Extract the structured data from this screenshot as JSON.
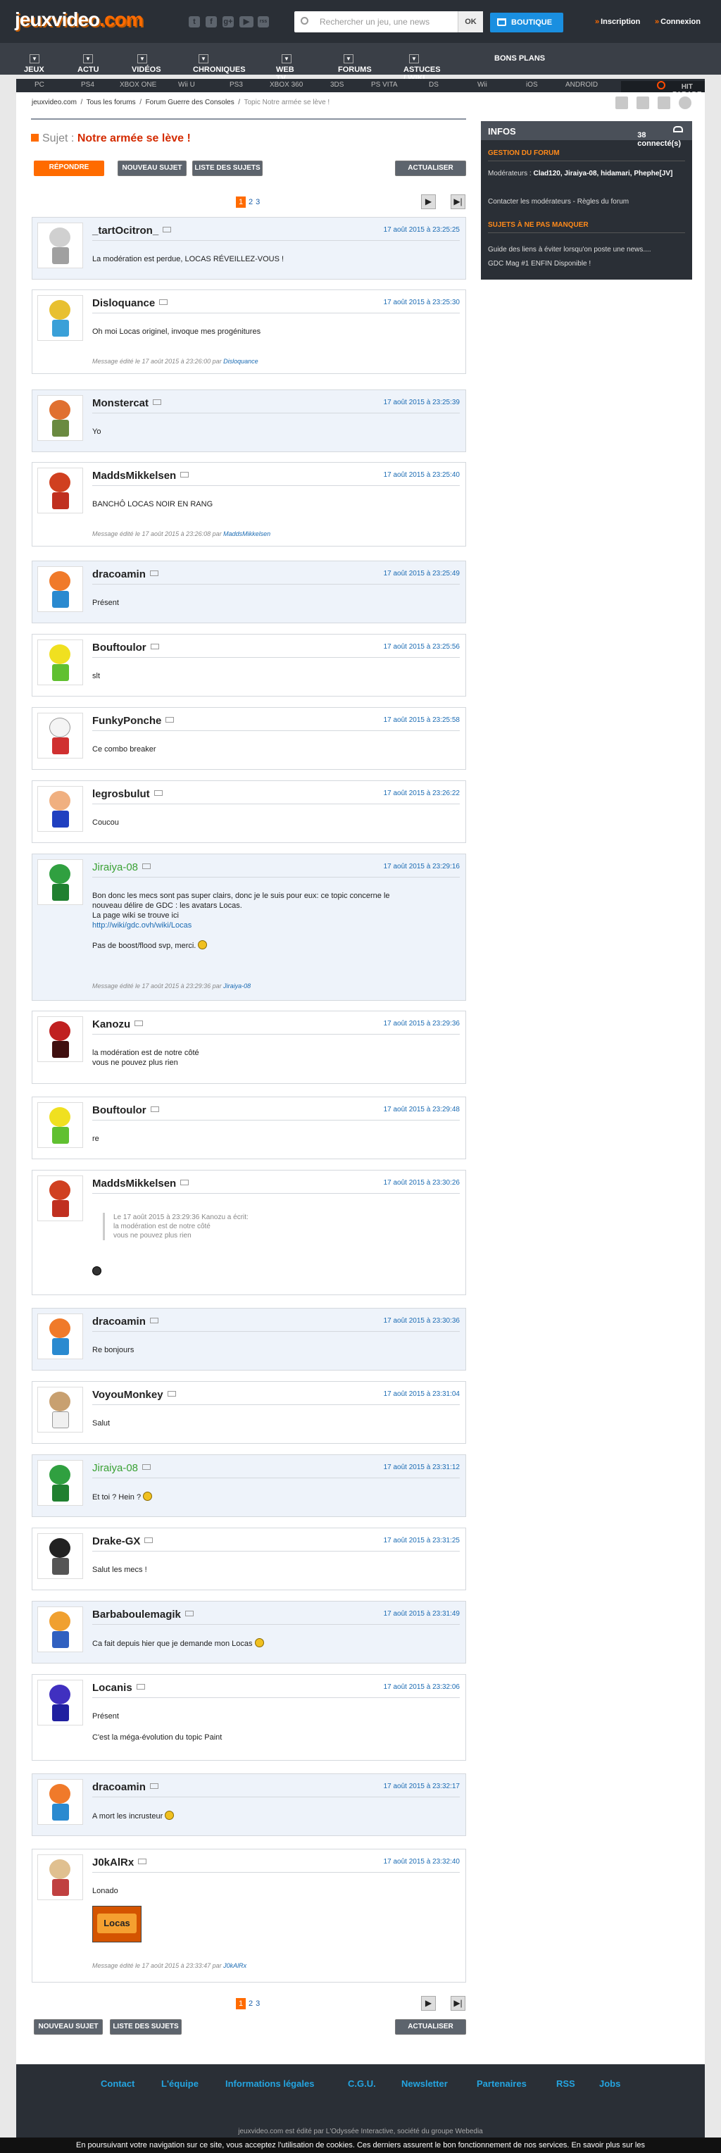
{
  "header": {
    "logo_main": "jeuxvideo",
    "logo_suffix": ".com",
    "social": [
      "t",
      "f",
      "g+",
      "▶",
      "rss"
    ],
    "search_placeholder": "Rechercher un jeu, une news",
    "search_btn": "OK",
    "shop": "BOUTIQUE",
    "signup": "Inscription",
    "login": "Connexion"
  },
  "nav": [
    "JEUX",
    "ACTU",
    "VIDÉOS",
    "CHRONIQUES",
    "WEB TV",
    "FORUMS",
    "ASTUCES / WIKI",
    "BONS PLANS"
  ],
  "platforms": [
    "PC",
    "PS4",
    "XBOX ONE",
    "Wii U",
    "PS3",
    "XBOX 360",
    "3DS",
    "PS VITA",
    "DS",
    "Wii",
    "iOS",
    "ANDROID"
  ],
  "hit_parade": "HIT PARADE",
  "breadcrumb": [
    "jeuxvideo.com",
    "Tous les forums",
    "Forum Guerre des Consoles",
    "Topic Notre armée se lève !"
  ],
  "topic": {
    "label": "Sujet :",
    "title": "Notre armée se lève !"
  },
  "buttons": {
    "reply": "RÉPONDRE",
    "new_topic": "NOUVEAU SUJET",
    "list": "LISTE DES SUJETS",
    "refresh": "ACTUALISER"
  },
  "pagination": {
    "current": "1",
    "pages": [
      "2",
      "3"
    ]
  },
  "sidebar": {
    "title": "INFOS",
    "connected": "38 connecté(s)",
    "section1": "GESTION DU FORUM",
    "mods_label": "Modérateurs :",
    "mods": "Clad120, Jiraiya-08, hidamari, Phephe[JV]",
    "contact": "Contacter les modérateurs - Règles du forum",
    "section2": "SUJETS À NE PAS MANQUER",
    "link1": "Guide des liens à éviter lorsqu'on poste une news....",
    "link2": "GDC Mag #1 ENFIN Disponible !"
  },
  "messages": [
    {
      "user": "_tartOcitron_",
      "date": "17 août 2015 à 23:25:25",
      "text": "La modération est perdue, LOCAS RÉVEILLEZ-VOUS !"
    },
    {
      "user": "Disloquance",
      "date": "17 août 2015 à 23:25:30",
      "text": "Oh moi Locas originel, invoque mes progénitures",
      "edit": "Message édité le 17 août 2015 à 23:26:00 par",
      "editor": "Disloquance"
    },
    {
      "user": "Monstercat",
      "date": "17 août 2015 à 23:25:39",
      "text": "Yo"
    },
    {
      "user": "MaddsMikkelsen",
      "date": "17 août 2015 à 23:25:40",
      "text": "BANCHÔ LOCAS NOIR EN RANG",
      "edit": "Message édité le 17 août 2015 à 23:26:08 par",
      "editor": "MaddsMikkelsen"
    },
    {
      "user": "dracoamin",
      "date": "17 août 2015 à 23:25:49",
      "text": "Présent"
    },
    {
      "user": "Bouftoulor",
      "date": "17 août 2015 à 23:25:56",
      "text": "slt"
    },
    {
      "user": "FunkyPonche",
      "date": "17 août 2015 à 23:25:58",
      "text": "Ce combo breaker"
    },
    {
      "user": "legrosbulut",
      "date": "17 août 2015 à 23:26:22",
      "text": "Coucou"
    },
    {
      "user": "Jiraiya-08",
      "date": "17 août 2015 à 23:29:16",
      "l1": "Bon donc les mecs sont pas super clairs, donc je le suis pour eux: ce topic concerne le",
      "l2": "nouveau délire de GDC : les avatars Locas.",
      "l3": "La page wiki se trouve ici",
      "link": "http://wiki/gdc.ovh/wiki/Locas",
      "l5": "Pas de boost/flood svp, merci.",
      "edit": "Message édité le 17 août 2015 à 23:29:36 par",
      "editor": "Jiraiya-08"
    },
    {
      "user": "Kanozu",
      "date": "17 août 2015 à 23:29:36",
      "l1": "la modération est de notre côté",
      "l2": "vous ne pouvez plus rien"
    },
    {
      "user": "Bouftoulor",
      "date": "17 août 2015 à 23:29:48",
      "text": "re"
    },
    {
      "user": "MaddsMikkelsen",
      "date": "17 août 2015 à 23:30:26",
      "q1": "Le 17 août 2015 à 23:29:36 Kanozu a écrit:",
      "q2": "la modération est de notre côté",
      "q3": "vous ne pouvez plus rien"
    },
    {
      "user": "dracoamin",
      "date": "17 août 2015 à 23:30:36",
      "text": "Re bonjours"
    },
    {
      "user": "VoyouMonkey",
      "date": "17 août 2015 à 23:31:04",
      "text": "Salut"
    },
    {
      "user": "Jiraiya-08",
      "date": "17 août 2015 à 23:31:12",
      "text": "Et toi ? Hein ?"
    },
    {
      "user": "Drake-GX",
      "date": "17 août 2015 à 23:31:25",
      "text": "Salut les mecs !"
    },
    {
      "user": "Barbaboulemagik",
      "date": "17 août 2015 à 23:31:49",
      "text": "Ca fait depuis hier que je demande mon Locas"
    },
    {
      "user": "Locanis",
      "date": "17 août 2015 à 23:32:06",
      "l1": "Présent",
      "l2": "C'est la méga-évolution du topic Paint"
    },
    {
      "user": "dracoamin",
      "date": "17 août 2015 à 23:32:17",
      "text": "A mort les incrusteur"
    },
    {
      "user": "J0kAlRx",
      "date": "17 août 2015 à 23:32:40",
      "text": "Lonado",
      "img": "Locas",
      "edit": "Message édité le 17 août 2015 à 23:33:47 par",
      "editor": "J0kAlRx"
    }
  ],
  "footer": {
    "links": [
      "Contact",
      "L'équipe",
      "Informations légales",
      "C.G.U.",
      "Newsletter",
      "Partenaires",
      "RSS",
      "Jobs"
    ],
    "copy": "jeuxvideo.com est édité par L'Odyssée Interactive, société du groupe Webedia"
  },
  "cookie": "En poursuivant votre navigation sur ce site, vous acceptez l'utilisation de cookies. Ces derniers assurent le bon fonctionnement de nos services. En savoir plus sur les",
  "colors": {
    "accent": "#ff6b00",
    "link": "#1b6bb3",
    "moderator": "#3aa134",
    "header": "#2a2f36"
  }
}
